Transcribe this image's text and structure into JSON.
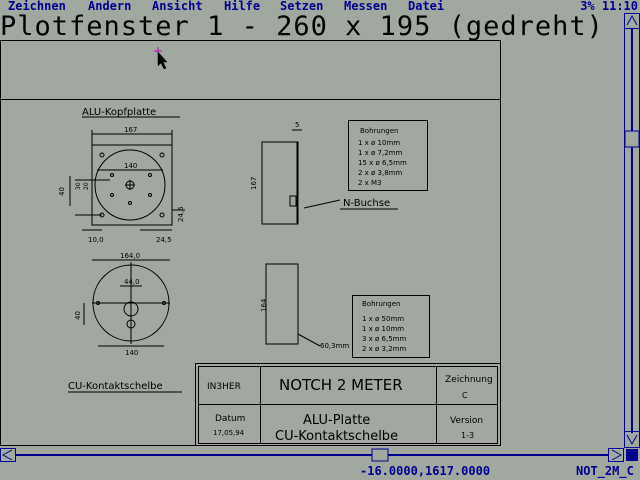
{
  "menu": {
    "items": [
      "Zeichnen",
      "Ändern",
      "Ansicht",
      "Hilfe",
      "Setzen",
      "Messen",
      "Datei"
    ],
    "status": "3% 11:10"
  },
  "window": {
    "title": "Plotfenster 1 - 260 x 195 (gedreht)"
  },
  "status": {
    "coords": "-16.0000,1617.0000",
    "filename": "NOT_2M_C"
  },
  "drawing": {
    "alu_title": "ALU-Kopfplatte",
    "cu_title": "CU-Kontaktschelbe",
    "n_buchse": "N-Buchse",
    "dims": {
      "d167": "167",
      "d140": "140",
      "d40": "40",
      "d30": "30",
      "d20": "20",
      "d10": "10",
      "d100": "10,0",
      "d245a": "24,5",
      "d245b": "24,5",
      "d5": "5",
      "d167v": "167",
      "d1640": "164,0",
      "d440": "44,0",
      "d40b": "40",
      "d140b": "140",
      "d164v": "164",
      "d603": "60,3mm"
    },
    "bohrungen1": {
      "title": "Bohrungen",
      "lines": [
        "1 x ø 10mm",
        "1 x ø 7,2mm",
        "15 x ø 6,5mm",
        "2 x ø 3,8mm",
        "2 x M3"
      ]
    },
    "bohrungen2": {
      "title": "Bohrungen",
      "lines": [
        "1 x ø 50mm",
        "1 x ø 10mm",
        "3 x ø 6,5mm",
        "2 x ø 3,2mm"
      ]
    },
    "titleblock": {
      "author": "IN3HER",
      "project": "NOTCH 2 METER",
      "zeichnung_label": "Zeichnung",
      "zeichnung_value": "C",
      "datum_label": "Datum",
      "datum_value": "17,05,94",
      "desc1": "ALU-Platte",
      "desc2": "CU-Kontaktschelbe",
      "version_label": "Version",
      "version_value": "1-3"
    }
  }
}
